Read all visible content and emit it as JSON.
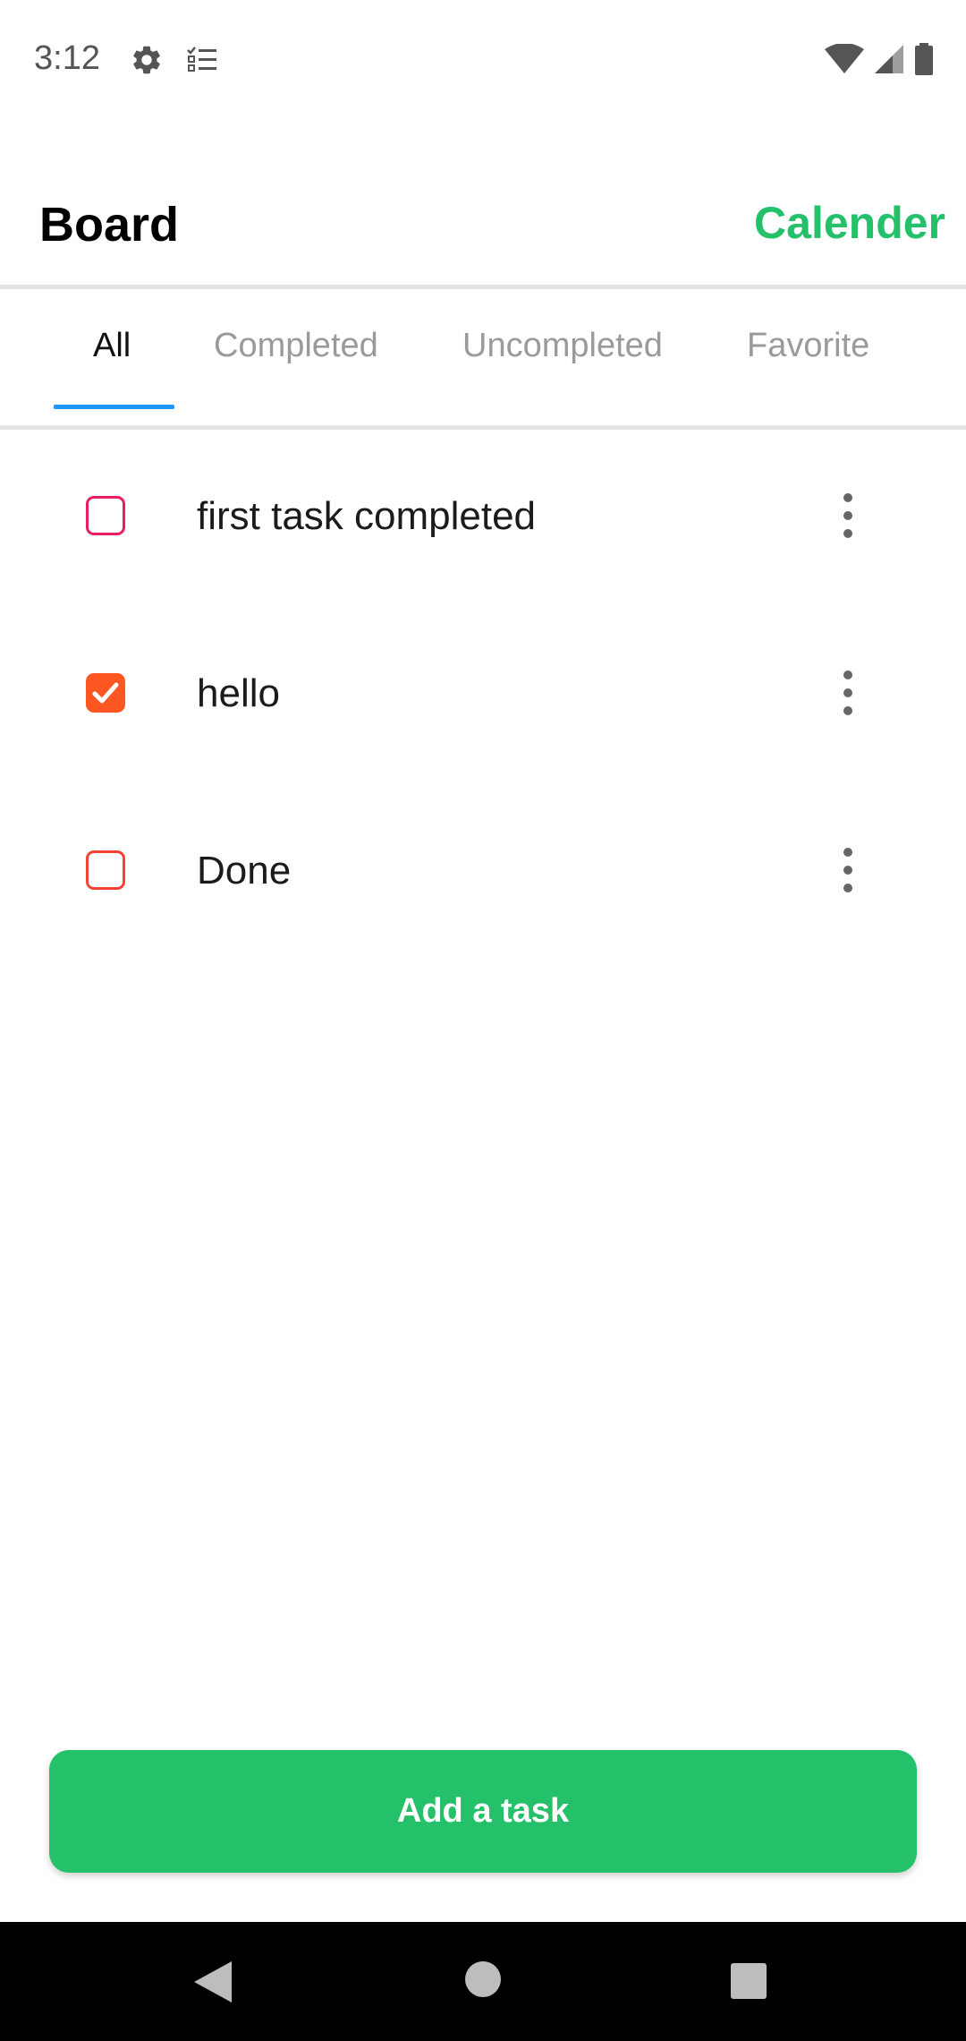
{
  "status_bar": {
    "time": "3:12",
    "icons": [
      "gear-icon",
      "checklist-icon",
      "wifi-icon",
      "signal-icon",
      "battery-icon"
    ]
  },
  "header": {
    "title": "Board",
    "calendar_link": "Calender"
  },
  "tabs": [
    {
      "label": "All",
      "active": true
    },
    {
      "label": "Completed",
      "active": false
    },
    {
      "label": "Uncompleted",
      "active": false
    },
    {
      "label": "Favorite",
      "active": false
    }
  ],
  "tasks": [
    {
      "text": "first task completed",
      "checked": false,
      "color": "#e91e63"
    },
    {
      "text": "hello",
      "checked": true,
      "color": "#ff5722"
    },
    {
      "text": "Done",
      "checked": false,
      "color": "#f44336"
    }
  ],
  "add_button": {
    "label": "Add a task"
  },
  "colors": {
    "accent_green": "#24c16a",
    "tab_indicator": "#2196f3",
    "tab_inactive": "#9a9a9a"
  },
  "nav_bar": {
    "icons": [
      "back-icon",
      "home-icon",
      "recents-icon"
    ]
  }
}
